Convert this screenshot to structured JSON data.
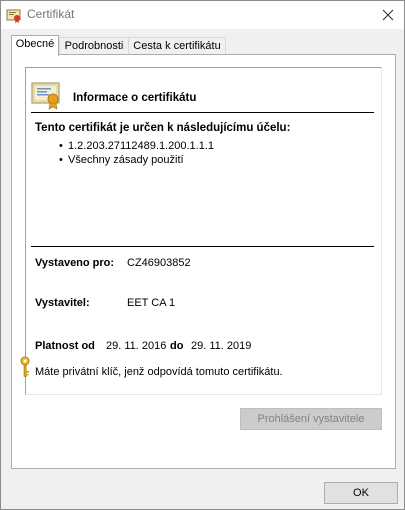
{
  "window": {
    "title": "Certifikát",
    "icon": "certificate-icon"
  },
  "tabs": [
    {
      "label": "Obecné",
      "active": true
    },
    {
      "label": "Podrobnosti",
      "active": false
    },
    {
      "label": "Cesta k certifikátu",
      "active": false
    }
  ],
  "info": {
    "heading": "Informace o certifikátu",
    "purpose_heading": "Tento certifikát je určen k následujícímu účelu:",
    "purposes": [
      "1.2.203.27112489.1.200.1.1.1",
      "Všechny zásady použití"
    ]
  },
  "details": {
    "issued_to_label": "Vystaveno pro:",
    "issued_to_value": "CZ46903852",
    "issuer_label": "Vystavitel:",
    "issuer_value": "EET CA 1",
    "valid_from_label": "Platnost od",
    "valid_from_value": "29. 11. 2016",
    "valid_to_label": "do",
    "valid_to_value": "29. 11. 2019",
    "private_key_note": "Máte privátní klíč, jenž odpovídá tomuto certifikátu."
  },
  "buttons": {
    "issuer_statement": "Prohlášení vystavitele",
    "ok": "OK"
  },
  "colors": {
    "window_bg": "#f0f0f0",
    "panel_bg": "#ffffff",
    "disabled_button_bg": "#cccccc",
    "disabled_text": "#838383"
  }
}
